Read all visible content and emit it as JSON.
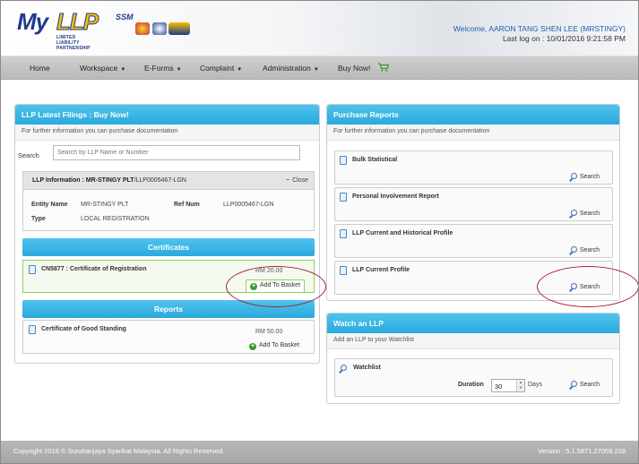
{
  "header": {
    "logo": {
      "my": "My",
      "llp": "LLP",
      "ssm": "SSM",
      "tagline": "LIMITED LIABILITY PARTNERSHIP"
    },
    "welcome_prefix": "Welcome,",
    "welcome_user": "AARON TANG SHEN LEE (MRSTINGY)",
    "last_logon": "Last log on : 10/01/2016 9:21:58 PM"
  },
  "nav": {
    "items": [
      {
        "label": "Home",
        "dropdown": false
      },
      {
        "label": "Workspace",
        "dropdown": true
      },
      {
        "label": "E-Forms",
        "dropdown": true
      },
      {
        "label": "Complaint",
        "dropdown": true
      },
      {
        "label": "Administration",
        "dropdown": true
      },
      {
        "label": "Buy Now!",
        "dropdown": false
      }
    ],
    "caret": "▼"
  },
  "left_panel": {
    "title": "LLP Latest Filings : Buy Now!",
    "subtitle": "For further information you can purchase documentation",
    "search_label": "Search",
    "search_placeholder": "Search by LLP Name or Number",
    "info": {
      "title_prefix": "LLP Information :",
      "entity_name_bold": "MR-STINGY PLT",
      "entity_ref": "/LLP0005467-LGN",
      "close_label": "Close",
      "entity_name_label": "Entity Name",
      "entity_name_value": "MR-STINGY PLT",
      "ref_num_label": "Ref Num",
      "ref_num_value": "LLP0005467-LGN",
      "type_label": "Type",
      "type_value": "LOCAL REGISTRATION"
    },
    "certificates_title": "Certificates",
    "certificates": [
      {
        "title": "CN5877 : Certificate of Registration",
        "price": "RM 20.00",
        "action": "Add To Basket"
      }
    ],
    "reports_title": "Reports",
    "reports": [
      {
        "title": "Certificate of Good Standing",
        "price": "RM 50.00",
        "action": "Add To Basket"
      }
    ]
  },
  "purchase_reports": {
    "title": "Purchase Reports",
    "subtitle": "For further information you can purchase documentation",
    "items": [
      {
        "title": "Bulk Statistical",
        "action": "Search"
      },
      {
        "title": "Personal Involvement Report",
        "action": "Search"
      },
      {
        "title": "LLP Current and Historical Profile",
        "action": "Search"
      },
      {
        "title": "LLP Current Profile",
        "action": "Search"
      }
    ]
  },
  "watch_panel": {
    "title": "Watch an LLP",
    "subtitle": "Add an LLP to your Watchlist",
    "watchlist_label": "Watchlist",
    "duration_label": "Duration",
    "duration_value": "30",
    "days_label": "Days",
    "action": "Search"
  },
  "footer": {
    "copyright": "Copyright 2016 © Suruhanjaya Syarikat Malaysia. All Rights Reserved.",
    "version": "Version : 5.1.5871.27059.228"
  },
  "colors": {
    "accent": "#2aa9dc",
    "brand_blue": "#1f3a8a",
    "brand_yellow": "#f2c200",
    "annotation": "#a8203a",
    "basket_green": "#3a9c2a"
  },
  "icons": {
    "cart": "cart-icon",
    "document": "document-icon",
    "search": "magnifier-icon",
    "add": "plus-circle-icon",
    "collapse": "minus-icon"
  }
}
